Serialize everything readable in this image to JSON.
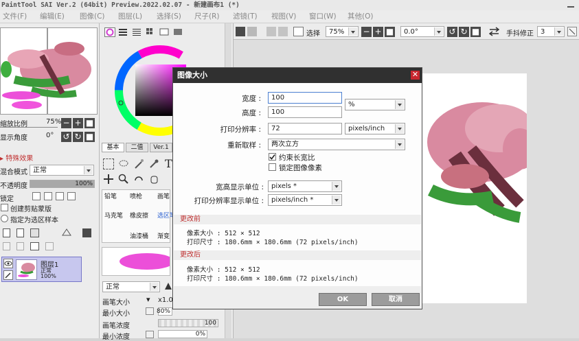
{
  "window": {
    "title": "PaintTool SAI Ver.2 (64bit) Preview.2022.02.07 - 新建画布1 (*)"
  },
  "menu": [
    "文件(F)",
    "编辑(E)",
    "图像(C)",
    "图层(L)",
    "选择(S)",
    "尺子(R)",
    "滤镜(T)",
    "视图(V)",
    "窗口(W)",
    "其他(O)"
  ],
  "navigator": {
    "zoom_label": "缩放比例",
    "zoom_value": "75%",
    "angle_label": "显示角度",
    "angle_value": "0°"
  },
  "effects": {
    "header": "特殊效果",
    "blend_mode_label": "混合模式",
    "blend_mode_value": "正常",
    "opacity_label": "不透明度",
    "opacity_value": "100%",
    "opacity_fraction": 1.0,
    "lock_label": "锁定",
    "clipping_label": "创建剪贴蒙版",
    "selection_source_label": "指定为选区样本"
  },
  "layers": {
    "items": [
      {
        "name": "图层1",
        "mode": "正常",
        "opacity": "100%"
      }
    ]
  },
  "color_panel": {
    "tabs": [
      "基本",
      "二值",
      "Ver.1"
    ],
    "accent_hue": "#ff00ff"
  },
  "tool_panel": {
    "tools": [
      "铅笔",
      "喷枪",
      "画笔",
      "马克笔",
      "橡皮擦",
      "选区笔",
      "油漆桶",
      "渐变"
    ],
    "blend_value": "正常",
    "brush_size_label": "画笔大小",
    "brush_size_value": "x1.0",
    "min_size_label": "最小大小",
    "min_size_value": "80%",
    "density_label": "画笔浓度",
    "density_value": "100",
    "min_density_label": "最小浓度",
    "min_density_value": "0%"
  },
  "top_toolbar": {
    "select_label": "选择",
    "zoom_value": "75%",
    "angle_value": "0.0°",
    "stabilizer_label": "手抖修正",
    "stabilizer_value": "3"
  },
  "dialog": {
    "title": "图像大小",
    "width_label": "宽度 :",
    "width_value": "100",
    "height_label": "高度 :",
    "height_value": "100",
    "unit_value": "%",
    "resolution_label": "打印分辨率 :",
    "resolution_value": "72",
    "resolution_unit": "pixels/inch",
    "resample_label": "重新取样 :",
    "resample_value": "两次立方",
    "constrain_label": "约束长宽比",
    "constrain_checked": true,
    "lock_pixels_label": "锁定图像像素",
    "lock_pixels_checked": false,
    "display_unit_label": "宽高显示单位 :",
    "display_unit_value": "pixels *",
    "display_res_unit_label": "打印分辨率显示单位 :",
    "display_res_unit_value": "pixels/inch *",
    "before_header": "更改前",
    "before_pixel_size": "像素大小 :  512 × 512",
    "before_print_size": "打印尺寸 :  180.6mm × 180.6mm (72 pixels/inch)",
    "after_header": "更改后",
    "after_pixel_size": "像素大小 :  512 × 512",
    "after_print_size": "打印尺寸 :  180.6mm × 180.6mm (72 pixels/inch)",
    "ok_label": "OK",
    "cancel_label": "取消"
  }
}
